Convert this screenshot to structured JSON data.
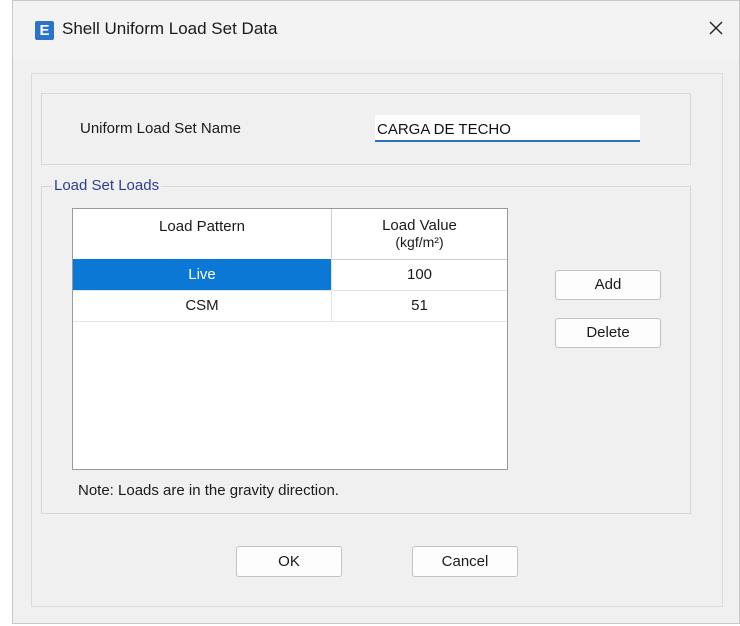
{
  "window": {
    "title": "Shell Uniform Load Set Data",
    "app_icon_letter": "E",
    "close_glyph": "close-icon"
  },
  "name_section": {
    "label": "Uniform Load Set Name",
    "value": "CARGA DE TECHO"
  },
  "loads_section": {
    "legend": "Load Set Loads",
    "columns": [
      "Load Pattern",
      "Load Value",
      "(kgf/m²)"
    ],
    "rows": [
      {
        "pattern": "Live",
        "value": "100",
        "selected": true
      },
      {
        "pattern": "CSM",
        "value": "51",
        "selected": false
      }
    ],
    "add_label": "Add",
    "delete_label": "Delete",
    "note": "Note:  Loads are in the gravity direction."
  },
  "footer": {
    "ok_label": "OK",
    "cancel_label": "Cancel"
  },
  "colors": {
    "accent": "#0a78d4",
    "icon": "#2b74c8",
    "legend_text": "#2a3f8f"
  }
}
